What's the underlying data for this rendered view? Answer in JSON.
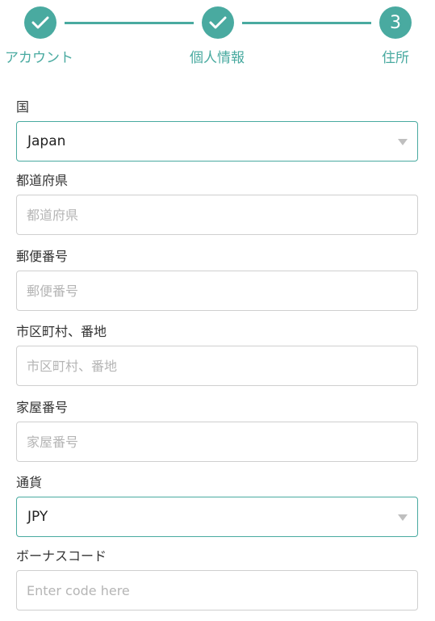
{
  "stepper": {
    "steps": [
      {
        "label": "アカウント",
        "state": "done",
        "icon": "check-icon"
      },
      {
        "label": "個人情報",
        "state": "done",
        "icon": "check-icon"
      },
      {
        "label": "住所",
        "state": "current",
        "number": "3"
      }
    ],
    "accent_color": "#49aaa0"
  },
  "form": {
    "country": {
      "label": "国",
      "value": "Japan"
    },
    "prefecture": {
      "label": "都道府県",
      "placeholder": "都道府県"
    },
    "postal_code": {
      "label": "郵便番号",
      "placeholder": "郵便番号"
    },
    "city": {
      "label": "市区町村、番地",
      "placeholder": "市区町村、番地"
    },
    "house_number": {
      "label": "家屋番号",
      "placeholder": "家屋番号"
    },
    "currency": {
      "label": "通貨",
      "value": "JPY"
    },
    "bonus_code": {
      "label": "ボーナスコード",
      "placeholder": "Enter code here"
    }
  }
}
